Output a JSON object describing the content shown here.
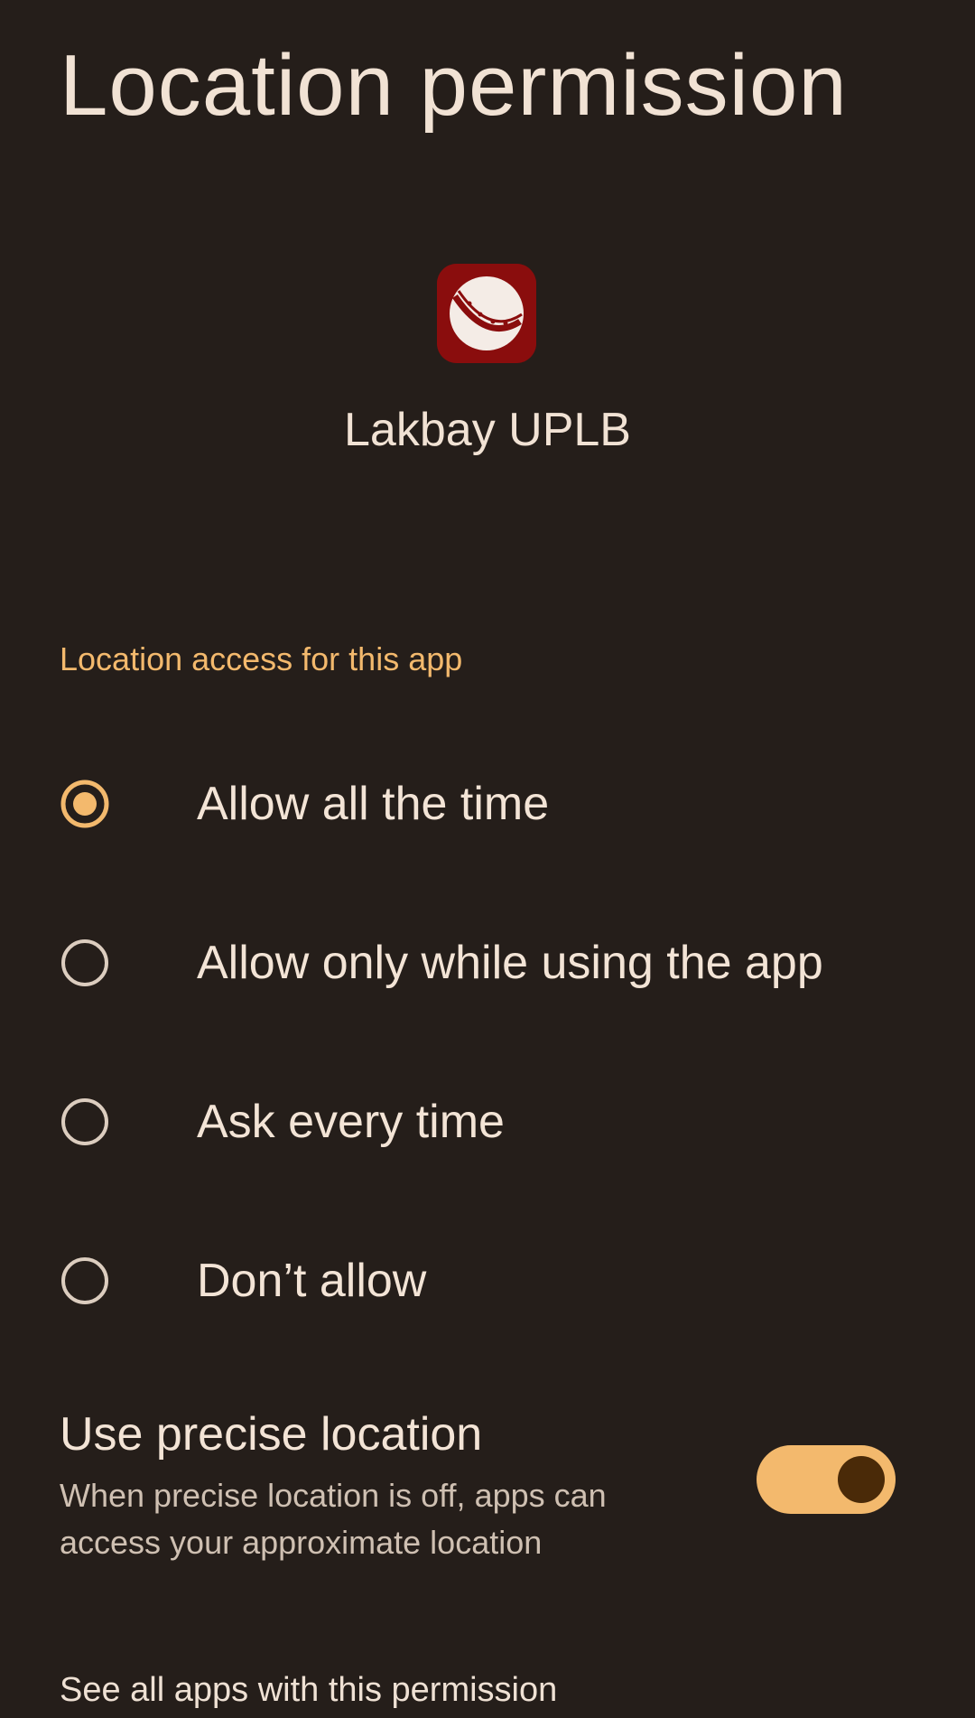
{
  "header": {
    "title": "Location permission"
  },
  "app": {
    "name": "Lakbay UPLB",
    "icon": "lakbay-uplb-app-icon"
  },
  "access": {
    "section_title": "Location access for this app",
    "selected": "Allow all the time",
    "options": [
      {
        "label": "Allow all the time",
        "selected": true
      },
      {
        "label": "Allow only while using the app",
        "selected": false
      },
      {
        "label": "Ask every time",
        "selected": false
      },
      {
        "label": "Don’t allow",
        "selected": false
      }
    ]
  },
  "precise": {
    "title": "Use precise location",
    "description": "When precise location is off, apps can access your approximate location",
    "enabled": true
  },
  "footer": {
    "see_all": "See all apps with this permission"
  },
  "colors": {
    "background": "#251e1a",
    "accent": "#f3b96d",
    "text": "#f3e4d6",
    "icon_bg": "#8a0d0d"
  }
}
